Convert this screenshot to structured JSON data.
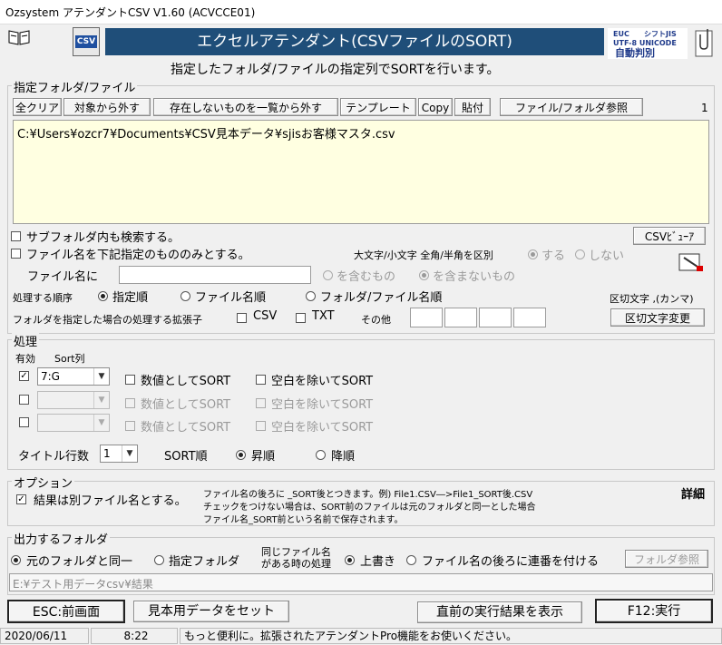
{
  "window": {
    "title": "Ozsystem アテンダントCSV V1.60 (ACVCCE01)"
  },
  "header": {
    "csv_badge": "CSV",
    "banner": "エクセルアテンダント(CSVファイルのSORT)",
    "subtitle": "指定したフォルダ/ファイルの指定列でSORTを行います。",
    "enc_line1a": "EUC",
    "enc_line1b": "シフトJIS",
    "enc_line2": "UTF-8 UNICODE",
    "enc_line3": "自動判別"
  },
  "files": {
    "legend": "指定フォルダ/ファイル",
    "buttons": {
      "clear_all": "全クリア",
      "remove": "対象から外す",
      "remove_missing": "存在しないものを一覧から外す",
      "template": "テンプレート",
      "copy": "Copy",
      "paste": "貼付",
      "browse": "ファイル/フォルダ参照"
    },
    "count": "1",
    "paths": [
      "C:¥Users¥ozcr7¥Documents¥CSV見本データ¥sjisお客様マスタ.csv"
    ],
    "subfolder_label": "サブフォルダ内も検索する。",
    "filename_only_label": "ファイル名を下記指定のもののみとする。",
    "csv_viewer": "CSVﾋﾞｭｰｱ",
    "case_label": "大文字/小文字 全角/半角を区別",
    "case_yes": "する",
    "case_no": "しない",
    "filename_label": "ファイル名に",
    "filename_value": "",
    "contains": "を含むもの",
    "not_contains": "を含まないもの",
    "order_label": "処理する順序",
    "order_specified": "指定順",
    "order_filename": "ファイル名順",
    "order_folderfile": "フォルダ/ファイル名順",
    "delim_label": "区切文字 ,(カンマ)",
    "ext_label": "フォルダを指定した場合の処理する拡張子",
    "ext_csv": "CSV",
    "ext_txt": "TXT",
    "ext_other": "その他",
    "delim_change": "区切文字変更"
  },
  "processing": {
    "legend": "処理",
    "col_enabled": "有効",
    "col_sort": "Sort列",
    "rows": [
      {
        "checked": true,
        "column": "7:G",
        "numeric": "数値としてSORT",
        "trim": "空白を除いてSORT",
        "disabled": false
      },
      {
        "checked": false,
        "column": "",
        "numeric": "数値としてSORT",
        "trim": "空白を除いてSORT",
        "disabled": true
      },
      {
        "checked": false,
        "column": "",
        "numeric": "数値としてSORT",
        "trim": "空白を除いてSORT",
        "disabled": true
      }
    ],
    "title_rows_label": "タイトル行数",
    "title_rows_value": "1",
    "sort_order_label": "SORT順",
    "ascending": "昇順",
    "descending": "降順"
  },
  "options": {
    "legend": "オプション",
    "separate_file": "結果は別ファイル名とする。",
    "desc1": "ファイル名の後ろに _SORT後とつきます。例) File1.CSV―>File1_SORT後.CSV",
    "desc2": "チェックをつけない場合は、SORT前のファイルは元のフォルダと同一とした場合",
    "desc3": "ファイル名_SORT前という名前で保存されます。",
    "details": "詳細"
  },
  "output": {
    "legend": "出力するフォルダ",
    "same_folder": "元のフォルダと同一",
    "specified_folder": "指定フォルダ",
    "same_name_l1": "同じファイル名",
    "same_name_l2": "がある時の処理",
    "overwrite": "上書き",
    "append_number": "ファイル名の後ろに連番を付ける",
    "folder_browse": "フォルダ参照",
    "path_placeholder": "E:¥テスト用データcsv¥結果"
  },
  "footer": {
    "esc": "ESC:前画面",
    "sample": "見本用データをセット",
    "show_result": "直前の実行結果を表示",
    "run": "F12:実行"
  },
  "statusbar": {
    "date": "2020/06/11",
    "time": "8:22",
    "message": "もっと便利に。拡張されたアテンダントPro機能をお使いください。"
  },
  "colors": {
    "banner_bg": "#1f4e79",
    "paths_bg": "#ffffe1",
    "enc_blue": "#1f3a8a"
  }
}
